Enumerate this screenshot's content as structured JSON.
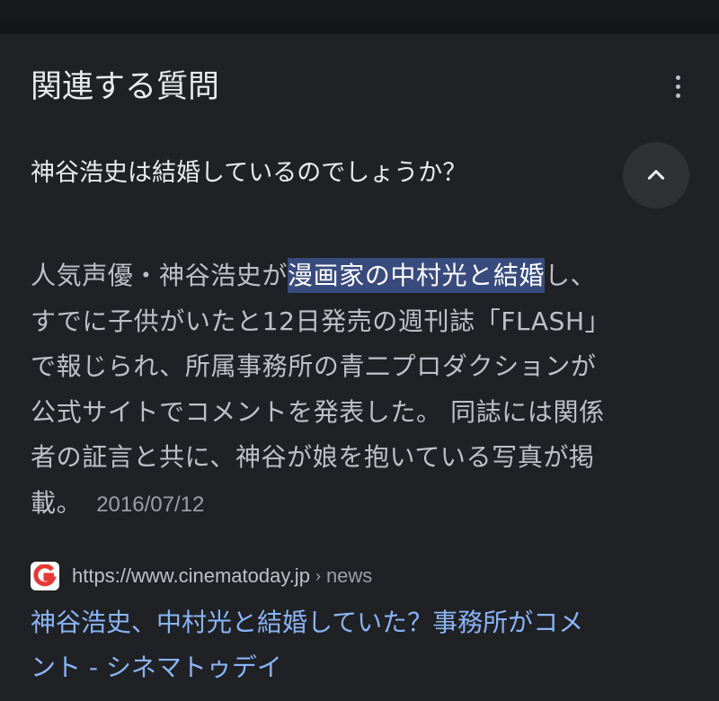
{
  "section": {
    "title": "関連する質問",
    "menu_icon": "more-vert-icon"
  },
  "question": {
    "text": "神谷浩史は結婚しているのでしょうか？",
    "toggle_icon": "chevron-up-icon"
  },
  "answer": {
    "line1_before": "人気声優・神谷浩史が",
    "line1_highlight": "漫画家の中村光と結婚",
    "line1_after": "し、",
    "line2": "すでに子供がいたと12日発売の週刊誌「FLASH」",
    "line3": "で報じられ、所属事務所の青二プロダクションが",
    "line4": "公式サイトでコメントを発表した。 同誌には関係",
    "line5": "者の証言と共に、神谷が娘を抱いている写真が掲",
    "line6": "載。",
    "date": "2016/07/12"
  },
  "source": {
    "favicon_icon": "cinematoday-logo-icon",
    "url": "https://www.cinematoday.jp",
    "separator": "›",
    "path": "news"
  },
  "result": {
    "title_line1": "神谷浩史、中村光と結婚していた？事務所がコメ",
    "title_line2": "ント - シネマトゥデイ"
  },
  "colors": {
    "background": "#202124",
    "text_primary": "#e8eaed",
    "text_secondary": "#bdc1c6",
    "link": "#8ab4f8",
    "highlight": "#394b7d",
    "favicon_red": "#e53935"
  }
}
